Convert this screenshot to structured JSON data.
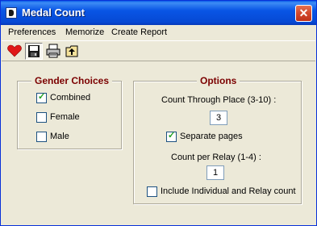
{
  "window": {
    "title": "Medal Count"
  },
  "menu": {
    "items": [
      "Preferences",
      "Memorize",
      "Create Report"
    ]
  },
  "toolbar": {
    "icons": [
      "heart-icon",
      "save-icon",
      "print-icon",
      "up-folder-icon"
    ]
  },
  "gender": {
    "title": "Gender Choices",
    "options": [
      {
        "label": "Combined",
        "checked": true
      },
      {
        "label": "Female",
        "checked": false
      },
      {
        "label": "Male",
        "checked": false
      }
    ]
  },
  "options": {
    "title": "Options",
    "count_through_label": "Count Through Place (3-10) :",
    "count_through_value": "3",
    "separate_pages_label": "Separate pages",
    "separate_pages_checked": true,
    "count_relay_label": "Count per Relay (1-4) :",
    "count_relay_value": "1",
    "include_label": "Include Individual and Relay count",
    "include_checked": false
  },
  "colors": {
    "title_bar": "#0955e5",
    "group_title": "#7b0000",
    "window_bg": "#ece9d8"
  }
}
